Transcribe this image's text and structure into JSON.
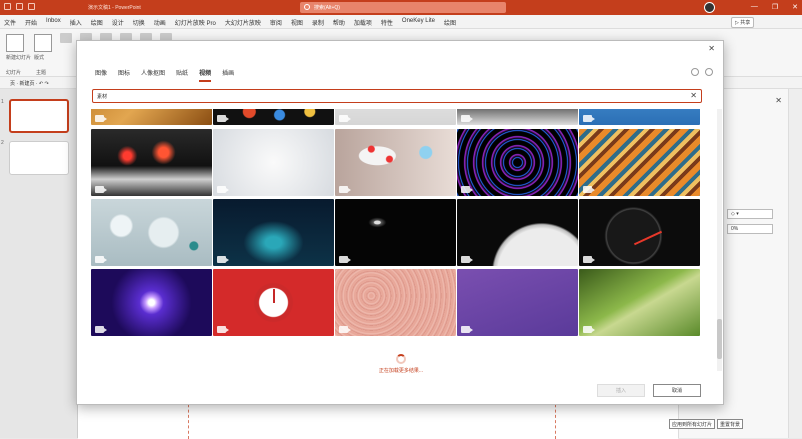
{
  "titlebar": {
    "doc_title": "演示文稿1 - PowerPoint",
    "search_placeholder": "搜索(Alt+Q)",
    "controls": [
      "—",
      "❐",
      "✕"
    ]
  },
  "menu_tabs": [
    "文件",
    "开始",
    "Inbox",
    "插入",
    "绘图",
    "设计",
    "切换",
    "动画",
    "幻灯片放映 Pro",
    "大幻灯片放映",
    "审阅",
    "视图",
    "录制",
    "帮助",
    "加载项",
    "特性",
    "OneKey Lite",
    "绘图"
  ],
  "share_label": "▷ 共享",
  "ribbon": {
    "new_slide_label": "新建幻灯片",
    "layout_label": "版式",
    "clipboard_label": "幻灯片",
    "reuse_label": "主题"
  },
  "subbar_label": "页 · 新建页 · ↶ ↷",
  "slides": [
    {
      "num": "1"
    },
    {
      "num": "2"
    }
  ],
  "right_pane": {
    "close": "✕",
    "fields": [
      "◇ ▾",
      "0%"
    ],
    "buttons": [
      "应用到所有幻灯片",
      "重置背景"
    ]
  },
  "dialog": {
    "close": "✕",
    "tabs": [
      {
        "label": "图像",
        "active": false
      },
      {
        "label": "图标",
        "active": false
      },
      {
        "label": "人像抠图",
        "active": false
      },
      {
        "label": "贴纸",
        "active": false
      },
      {
        "label": "视频",
        "active": true
      },
      {
        "label": "插画",
        "active": false
      }
    ],
    "search_value": "素材",
    "search_clear": "✕",
    "loading_text": "正在加载更多结果...",
    "insert_label": "插入",
    "cancel_label": "取消"
  }
}
